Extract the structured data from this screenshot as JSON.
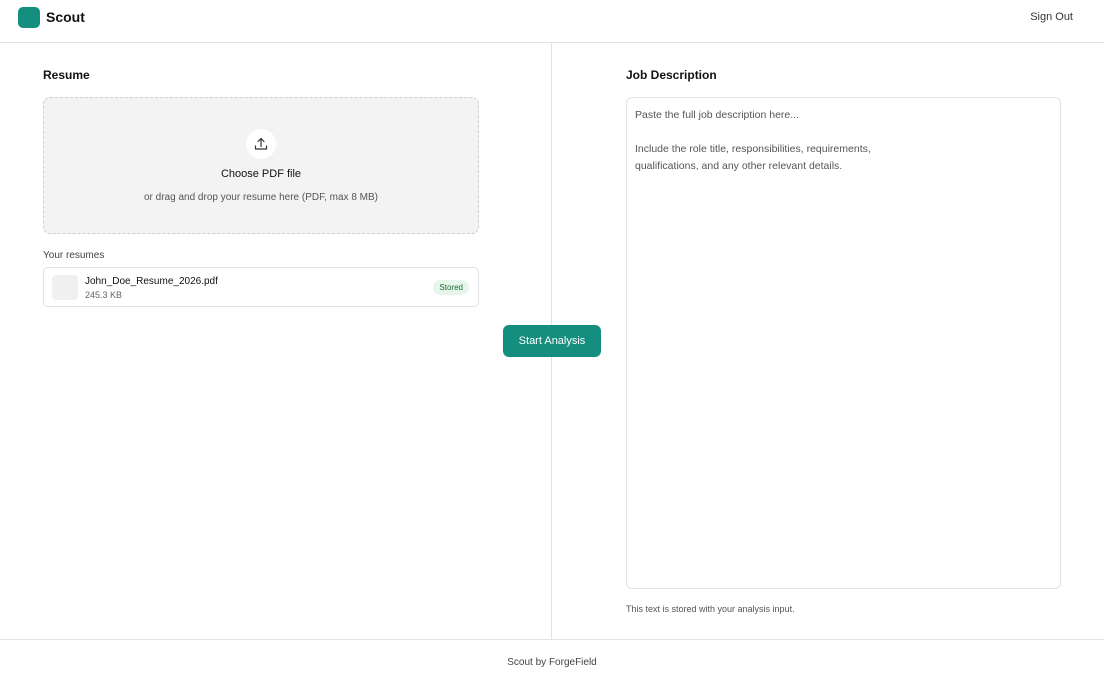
{
  "header": {
    "app_name": "Scout",
    "sign_out_label": "Sign Out",
    "brand_color": "#138e7f"
  },
  "resume": {
    "title": "Resume",
    "upload": {
      "icon": "upload-icon",
      "choose_label": "Choose PDF file",
      "hint": "or drag and drop your resume here (PDF, max 8 MB)"
    },
    "list_label": "Your resumes",
    "files": [
      {
        "name": "John_Doe_Resume_2026.pdf",
        "size": "245.3 KB",
        "badge": "Stored"
      }
    ]
  },
  "actions": {
    "start_label": "Start Analysis"
  },
  "job_description": {
    "title": "Job Description",
    "placeholder": "Paste the full job description here...\n\nInclude the role title, responsibilities, requirements,\nqualifications, and any other relevant details.",
    "value": "",
    "footnote": "This text is stored with your analysis input."
  },
  "footer": {
    "text": "Scout by ForgeField"
  }
}
